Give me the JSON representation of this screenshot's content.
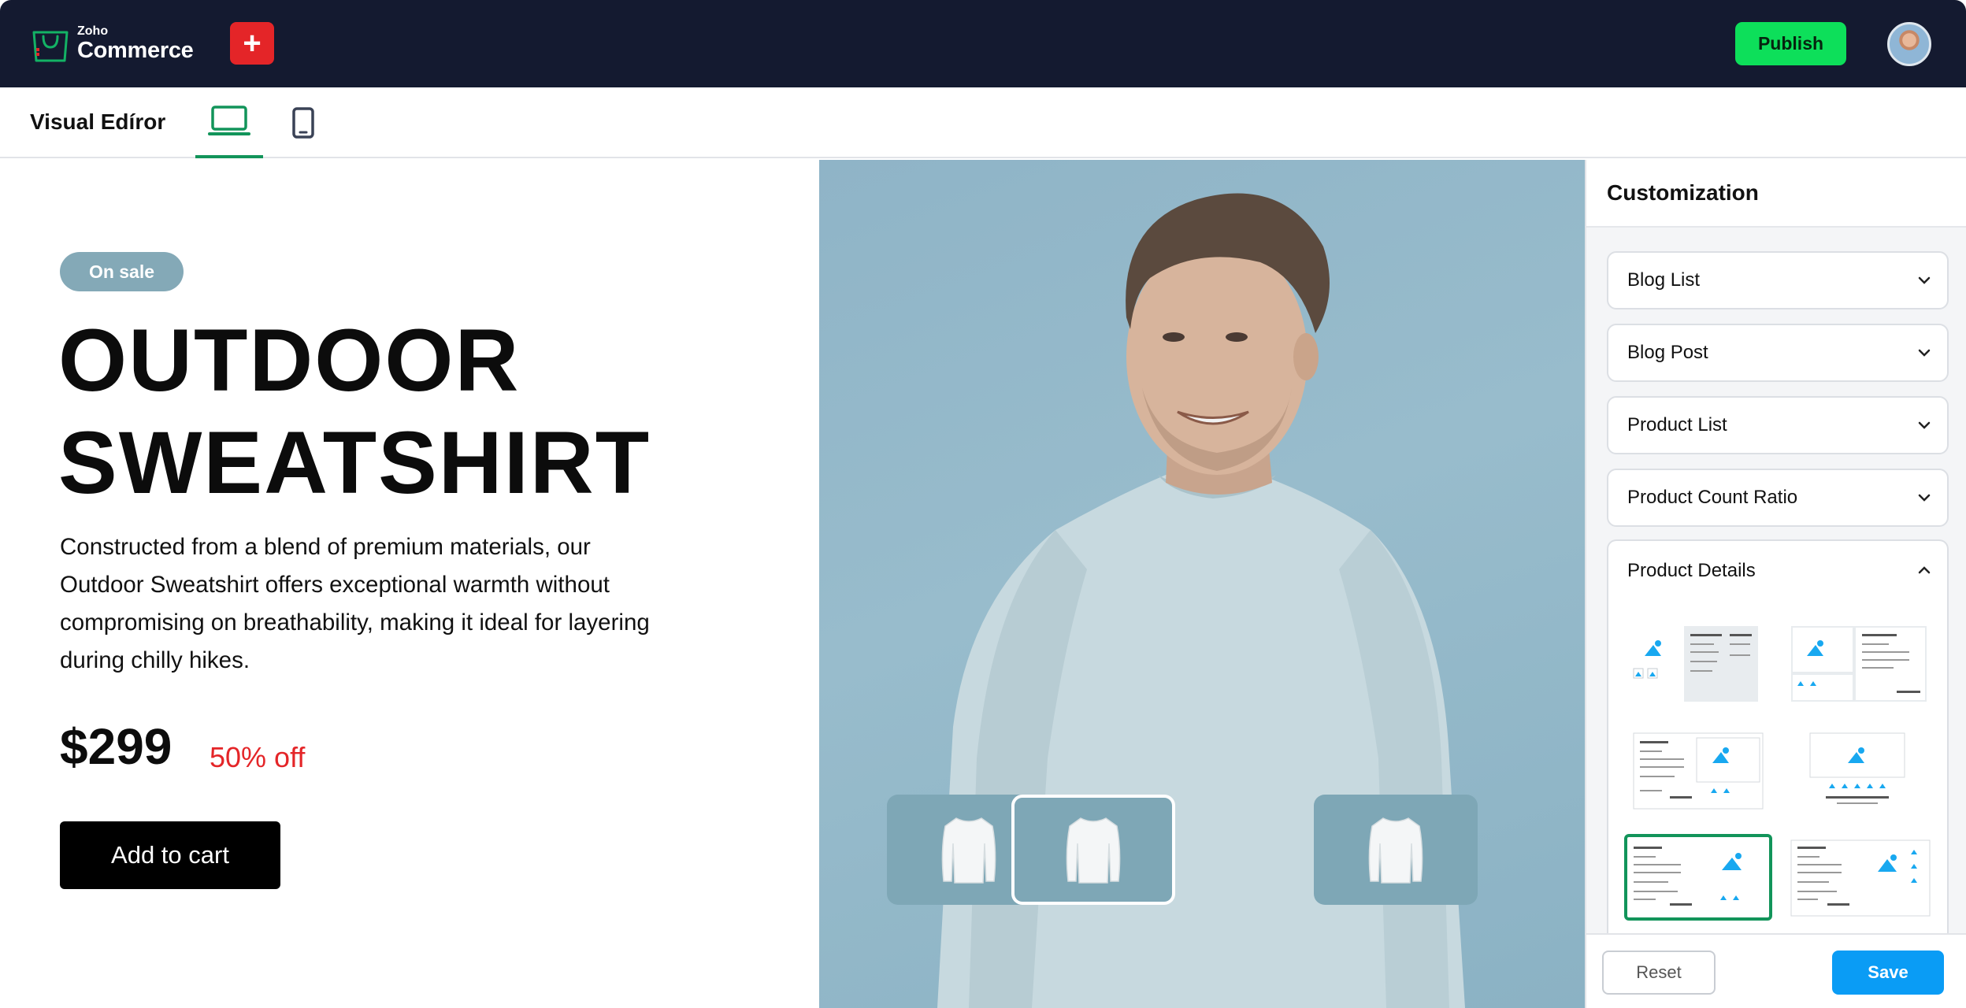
{
  "topbar": {
    "logo_small": "Zoho",
    "logo_big": "Commerce",
    "add_label": "+",
    "publish_label": "Publish",
    "avatar_icon": "user-avatar"
  },
  "editor": {
    "title": "Visual Edíror",
    "tabs": [
      {
        "name": "desktop",
        "icon": "laptop-icon",
        "active": true
      },
      {
        "name": "mobile",
        "icon": "mobile-icon",
        "active": false
      }
    ]
  },
  "product": {
    "badge": "On sale",
    "title_line1": "OUTDOOR",
    "title_line2": "SWEATSHIRT",
    "description": "Constructed from a blend of premium materials, our Outdoor Sweatshirt offers exceptional warmth without compromising on breathability, making it ideal for layering during chilly hikes.",
    "price": "$299",
    "discount": "50% off",
    "cart_label": "Add to cart"
  },
  "gallery": {
    "selected_index": 1,
    "thumbnails": [
      "sweatshirt-front-thumb",
      "sweatshirt-front-thumb",
      "sweatshirt-front-thumb"
    ]
  },
  "sidebar": {
    "title": "Customization",
    "sections": [
      {
        "label": "Blog List",
        "expanded": false
      },
      {
        "label": "Blog Post",
        "expanded": false
      },
      {
        "label": "Product List",
        "expanded": false
      },
      {
        "label": "Product Count Ratio",
        "expanded": false
      },
      {
        "label": "Product Details",
        "expanded": true
      }
    ],
    "layouts": [
      {
        "name": "image-left-details-panel",
        "selected": false
      },
      {
        "name": "image-left-details-boxed",
        "selected": false
      },
      {
        "name": "details-left-image-right",
        "selected": false
      },
      {
        "name": "image-center-stacked",
        "selected": false
      },
      {
        "name": "details-left-image-right-thumbs",
        "selected": true
      },
      {
        "name": "details-left-image-right-vertical-thumbs",
        "selected": false
      }
    ],
    "reset_label": "Reset",
    "save_label": "Save"
  },
  "colors": {
    "topbar": "#141a30",
    "accent_green": "#12945a",
    "publish": "#0ddf5a",
    "danger": "#e42528",
    "save": "#0a9cf5",
    "hero": "#8fb4c7",
    "badge": "#84a9b7"
  }
}
